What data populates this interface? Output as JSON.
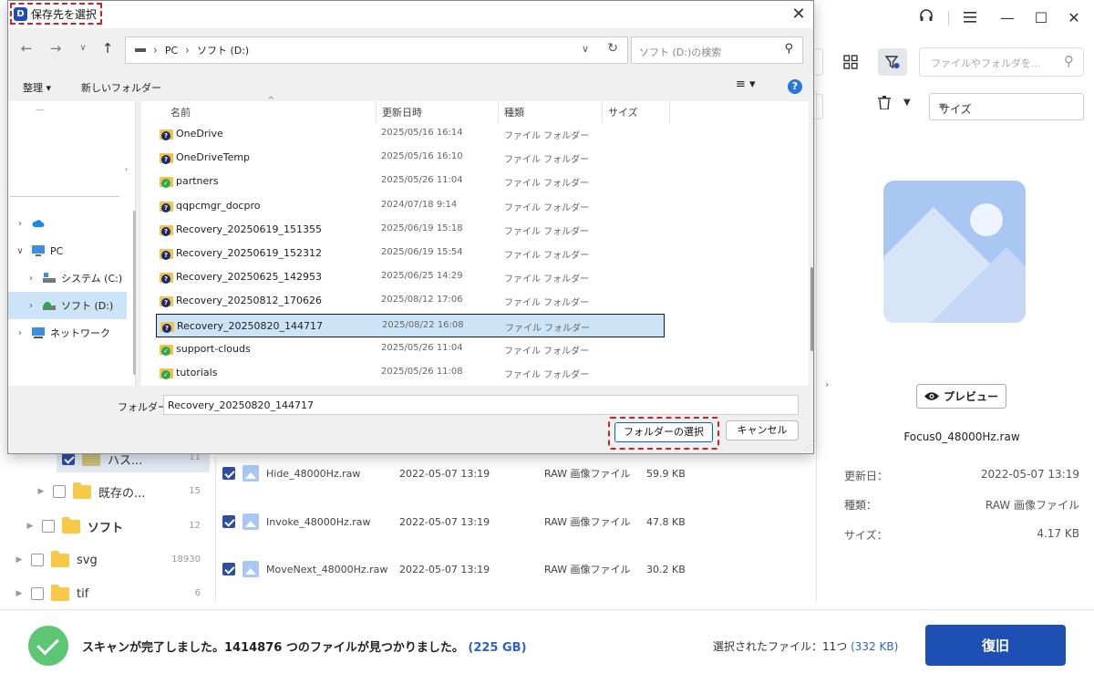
{
  "app": {
    "topbar": {
      "headset_icon": "headset-icon",
      "menu_icon": "hamburger-icon",
      "minimize": "—",
      "maximize": "☐",
      "close": "✕"
    },
    "toolbar": {
      "search_placeholder": "ファイルやフォルダを..."
    },
    "filter": {
      "size_select": "サイズ"
    },
    "tree": [
      {
        "label": "ハス...",
        "count": "11"
      },
      {
        "label": "既存の...",
        "count": "15"
      },
      {
        "label": "ソフト",
        "count": "12"
      },
      {
        "label": "svg",
        "count": "18930"
      },
      {
        "label": "tif",
        "count": "6"
      }
    ],
    "files": [
      {
        "name": "Hide_48000Hz.raw",
        "date": "2022-05-07 13:19",
        "type": "RAW 画像ファイル",
        "size": "59.9 KB"
      },
      {
        "name": "Invoke_48000Hz.raw",
        "date": "2022-05-07 13:19",
        "type": "RAW 画像ファイル",
        "size": "47.8 KB"
      },
      {
        "name": "MoveNext_48000Hz.raw",
        "date": "2022-05-07 13:19",
        "type": "RAW 画像ファイル",
        "size": "30.2 KB"
      }
    ],
    "preview": {
      "button": "プレビュー",
      "filename": "Focus0_48000Hz.raw",
      "meta": [
        {
          "key": "更新日：",
          "value": "2022-05-07 13:19"
        },
        {
          "key": "種類：",
          "value": "RAW 画像ファイル"
        },
        {
          "key": "サイズ：",
          "value": "4.17 KB"
        }
      ]
    },
    "status": {
      "message": "スキャンが完了しました。1414876 つのファイルが見つかりました。",
      "total_size": "(225 GB)",
      "selected": "選択されたファイル：11つ",
      "selected_size": "(332 KB)",
      "recover_button": "復旧"
    }
  },
  "dialog": {
    "title": "保存先を選択",
    "address": {
      "crumbs": [
        "PC",
        "ソフト (D:)"
      ]
    },
    "search_placeholder": "ソフト (D:)の検索",
    "commands": {
      "organize": "整理 ▾",
      "new_folder": "新しいフォルダー"
    },
    "nav": [
      {
        "label": "",
        "icon": "onedrive-icon"
      },
      {
        "label": "PC",
        "icon": "pc-icon"
      },
      {
        "label": "システム (C:)",
        "icon": "drive-icon"
      },
      {
        "label": "ソフト (D:)",
        "icon": "drive-icon"
      },
      {
        "label": "ネットワーク",
        "icon": "network-icon"
      }
    ],
    "columns": {
      "name": "名前",
      "date": "更新日時",
      "type": "種類",
      "size": "サイズ"
    },
    "folders": [
      {
        "name": "OneDrive",
        "date": "2025/05/16 16:14",
        "type": "ファイル フォルダー",
        "status": "q"
      },
      {
        "name": "OneDriveTemp",
        "date": "2025/05/16 16:10",
        "type": "ファイル フォルダー",
        "status": "q"
      },
      {
        "name": "partners",
        "date": "2025/05/26 11:04",
        "type": "ファイル フォルダー",
        "status": "g"
      },
      {
        "name": "qqpcmgr_docpro",
        "date": "2024/07/18 9:14",
        "type": "ファイル フォルダー",
        "status": "q"
      },
      {
        "name": "Recovery_20250619_151355",
        "date": "2025/06/19 15:18",
        "type": "ファイル フォルダー",
        "status": "q"
      },
      {
        "name": "Recovery_20250619_152312",
        "date": "2025/06/19 15:54",
        "type": "ファイル フォルダー",
        "status": "q"
      },
      {
        "name": "Recovery_20250625_142953",
        "date": "2025/06/25 14:29",
        "type": "ファイル フォルダー",
        "status": "q"
      },
      {
        "name": "Recovery_20250812_170626",
        "date": "2025/08/12 17:06",
        "type": "ファイル フォルダー",
        "status": "q"
      },
      {
        "name": "Recovery_20250820_144717",
        "date": "2025/08/22 16:08",
        "type": "ファイル フォルダー",
        "status": "q"
      },
      {
        "name": "support-clouds",
        "date": "2025/05/26 11:04",
        "type": "ファイル フォルダー",
        "status": "g"
      },
      {
        "name": "tutorials",
        "date": "2025/05/26 11:08",
        "type": "ファイル フォルダー",
        "status": "g"
      }
    ],
    "selected_index": 8,
    "folder_label": "フォルダー:",
    "folder_value": "Recovery_20250820_144717",
    "select_button": "フォルダーの選択",
    "cancel_button": "キャンセル"
  }
}
